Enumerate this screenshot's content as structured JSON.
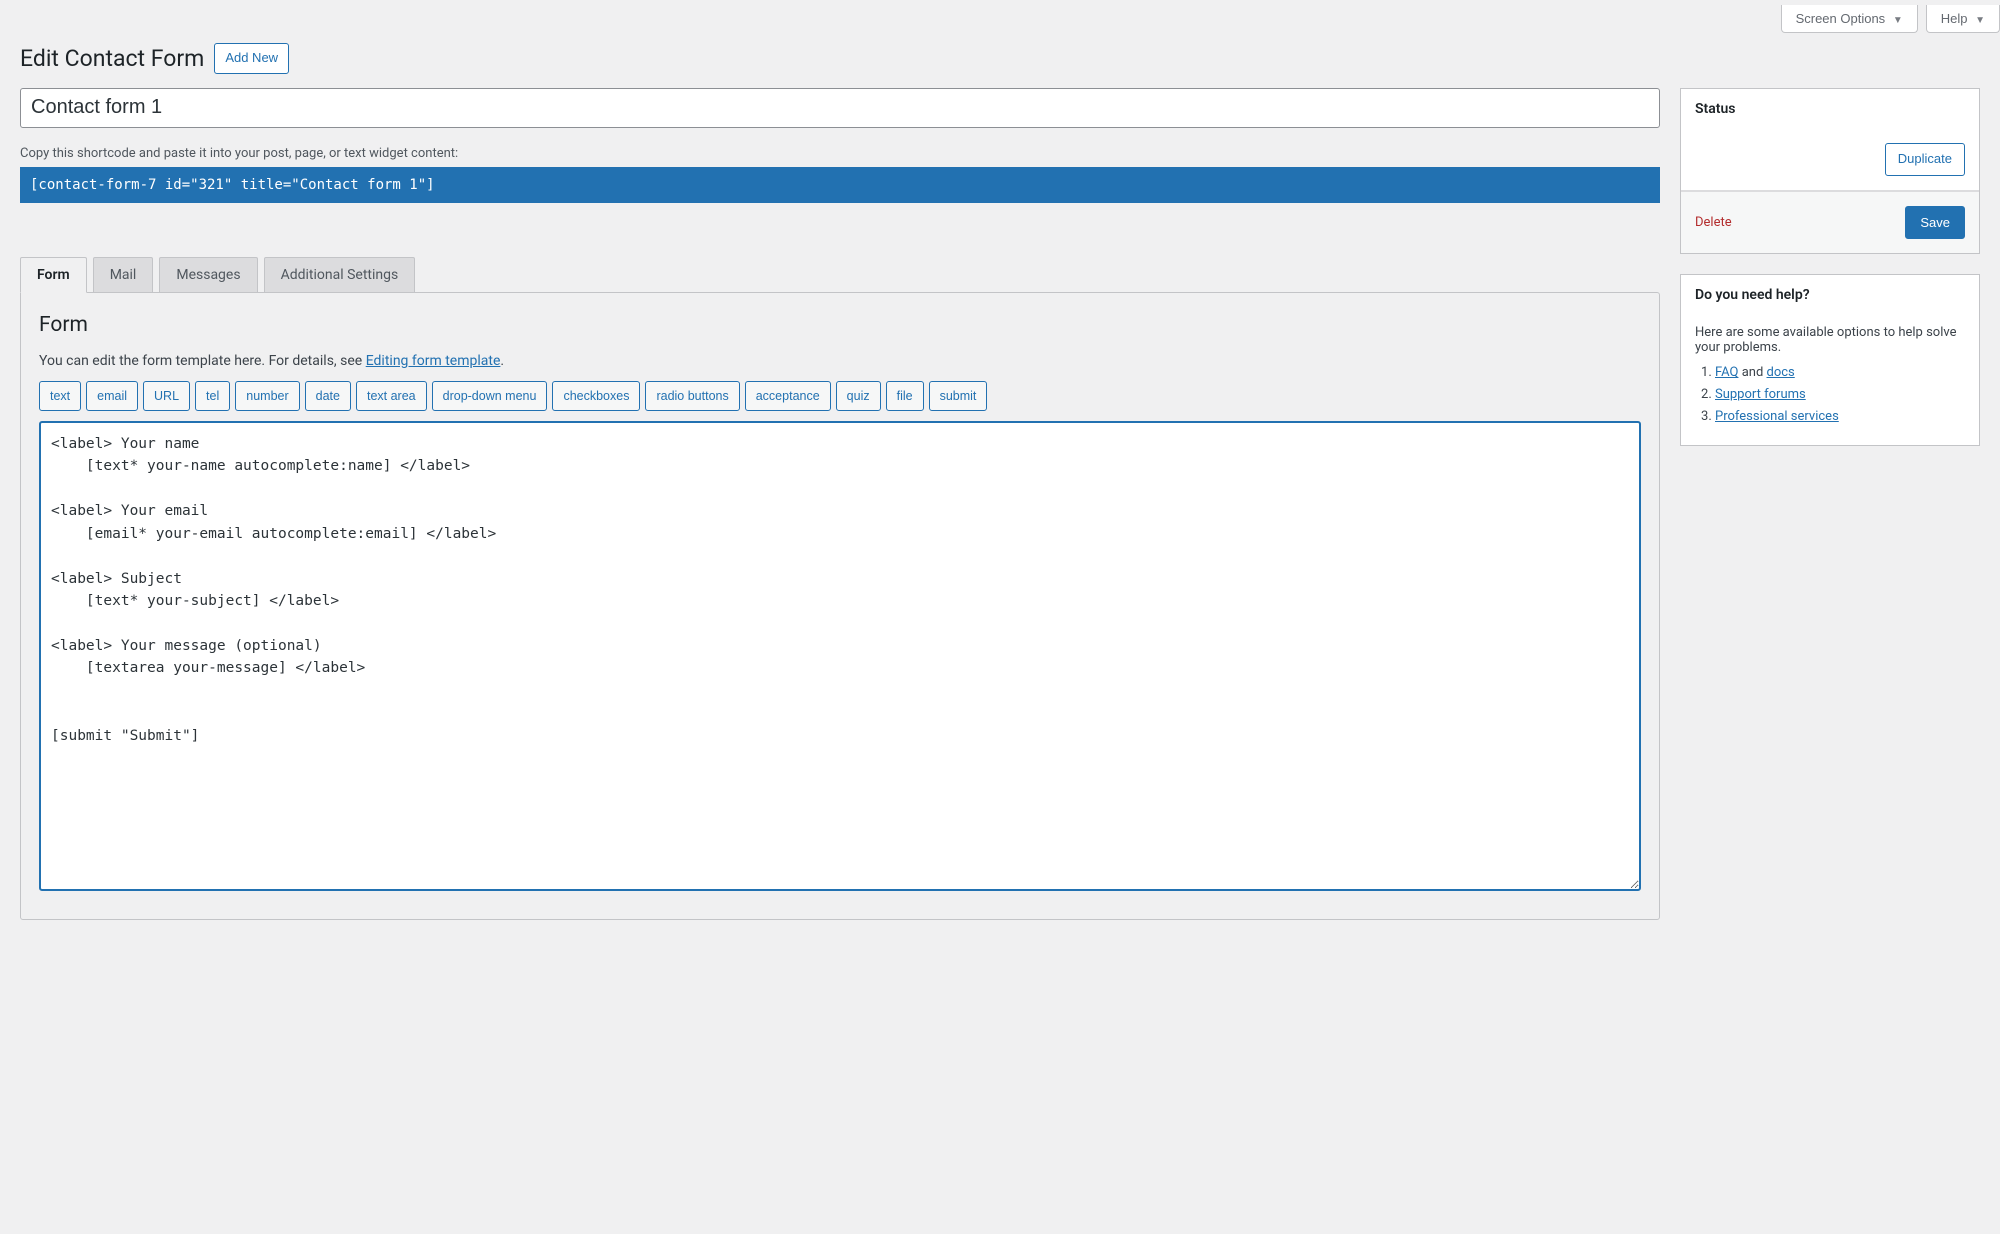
{
  "topButtons": {
    "screenOptions": "Screen Options",
    "help": "Help"
  },
  "header": {
    "title": "Edit Contact Form",
    "addNew": "Add New"
  },
  "formTitle": "Contact form 1",
  "shortcode": {
    "hint": "Copy this shortcode and paste it into your post, page, or text widget content:",
    "code": "[contact-form-7 id=\"321\" title=\"Contact form 1\"]"
  },
  "tabs": {
    "form": "Form",
    "mail": "Mail",
    "messages": "Messages",
    "additional": "Additional Settings"
  },
  "panel": {
    "heading": "Form",
    "descPrefix": "You can edit the form template here. For details, see ",
    "descLink": "Editing form template",
    "descSuffix": ".",
    "tagButtons": [
      "text",
      "email",
      "URL",
      "tel",
      "number",
      "date",
      "text area",
      "drop-down menu",
      "checkboxes",
      "radio buttons",
      "acceptance",
      "quiz",
      "file",
      "submit"
    ],
    "template": "<label> Your name\n    [text* your-name autocomplete:name] </label>\n\n<label> Your email\n    [email* your-email autocomplete:email] </label>\n\n<label> Subject\n    [text* your-subject] </label>\n\n<label> Your message (optional)\n    [textarea your-message] </label>\n\n\n[submit \"Submit\"]"
  },
  "statusBox": {
    "title": "Status",
    "duplicate": "Duplicate",
    "delete": "Delete",
    "save": "Save"
  },
  "helpBox": {
    "title": "Do you need help?",
    "intro": "Here are some available options to help solve your problems.",
    "item1a": "FAQ",
    "item1mid": " and ",
    "item1b": "docs",
    "item2": "Support forums",
    "item3": "Professional services"
  }
}
